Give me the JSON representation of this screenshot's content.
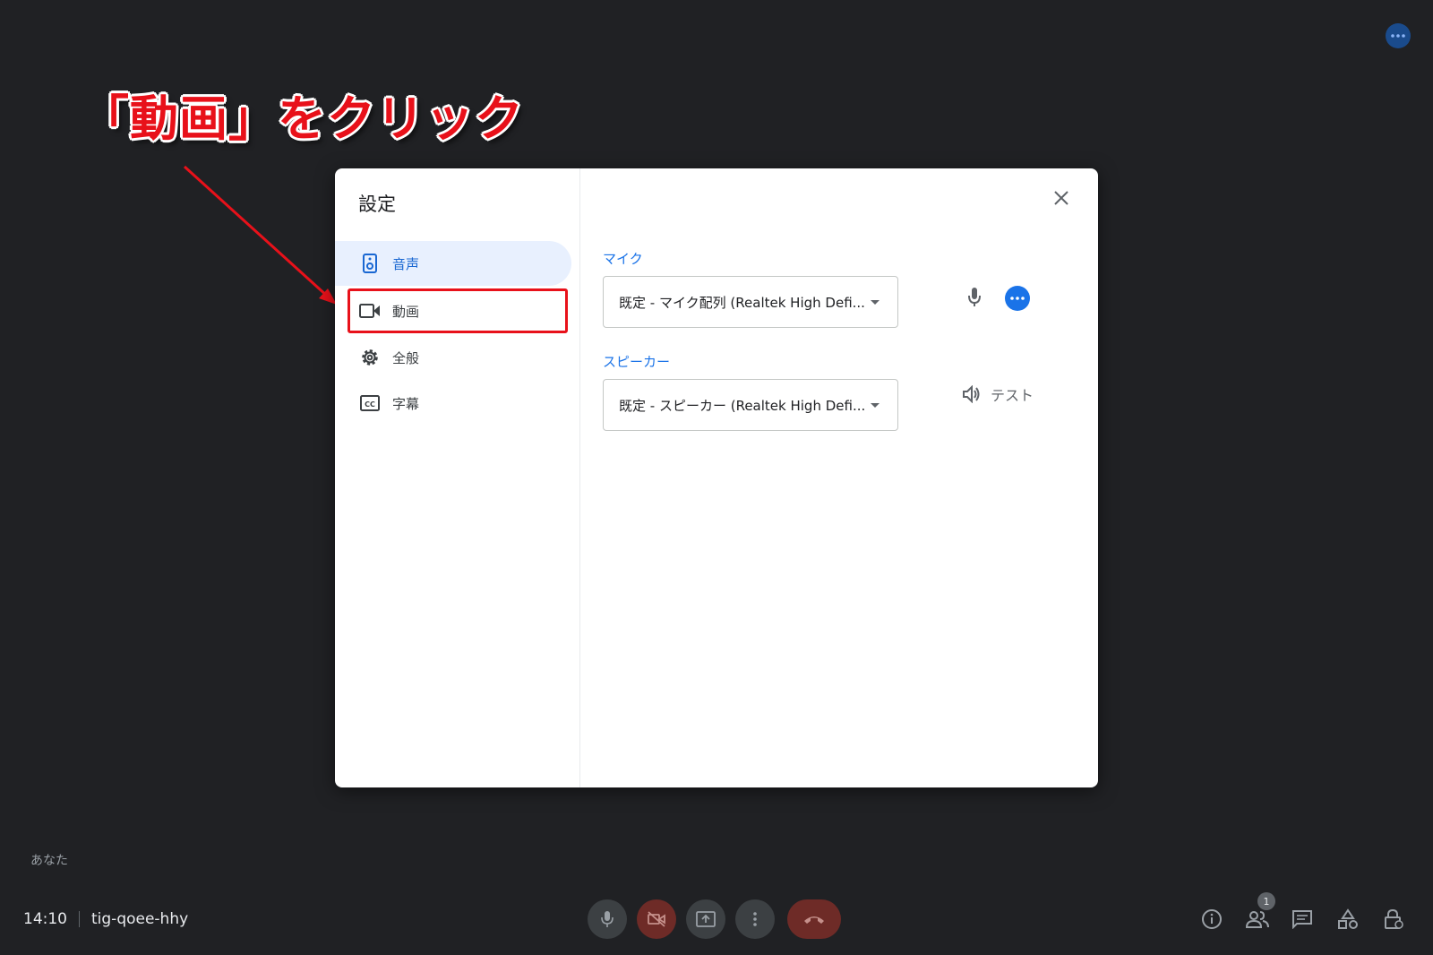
{
  "annotation": {
    "text": "「動画」をクリック"
  },
  "dialog": {
    "title": "設定",
    "nav": [
      {
        "label": "音声",
        "icon": "speaker-icon",
        "active": true
      },
      {
        "label": "動画",
        "icon": "video-camera-icon",
        "active": false
      },
      {
        "label": "全般",
        "icon": "gear-icon",
        "active": false
      },
      {
        "label": "字幕",
        "icon": "closed-caption-icon",
        "active": false
      }
    ],
    "mic": {
      "label": "マイク",
      "selected": "既定 - マイク配列 (Realtek High Defi..."
    },
    "speaker": {
      "label": "スピーカー",
      "selected": "既定 - スピーカー (Realtek High Defi...",
      "test_label": "テスト"
    }
  },
  "bottom": {
    "you_label": "あなた",
    "time": "14:10",
    "meeting_code": "tig-qoee-hhy",
    "participants_count": "1"
  },
  "colors": {
    "background": "#202124",
    "accent": "#1a73e8",
    "annotation": "#e8111a",
    "hangup": "#6e2b27"
  }
}
